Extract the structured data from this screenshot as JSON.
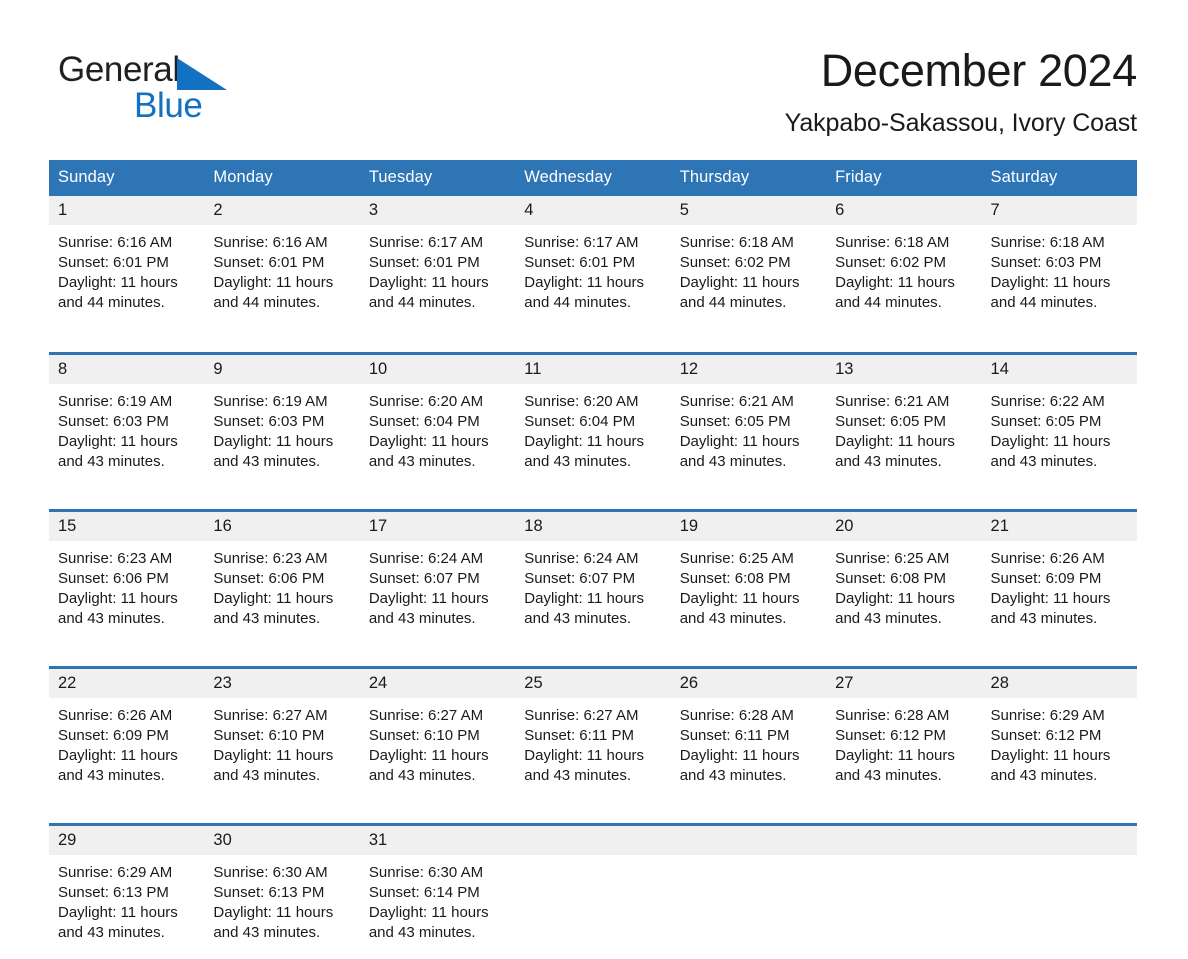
{
  "brand": {
    "name_part1": "General",
    "name_part2": "Blue",
    "triangle_color": "#1271c1"
  },
  "header": {
    "title": "December 2024",
    "subtitle": "Yakpabo-Sakassou, Ivory Coast"
  },
  "theme": {
    "header_blue": "#2e75b6",
    "date_band_gray": "#f0f0f0",
    "text_color": "#1a1a1a"
  },
  "weekday_headers": [
    "Sunday",
    "Monday",
    "Tuesday",
    "Wednesday",
    "Thursday",
    "Friday",
    "Saturday"
  ],
  "weeks": [
    {
      "days": [
        {
          "date": "1",
          "sunrise": "Sunrise: 6:16 AM",
          "sunset": "Sunset: 6:01 PM",
          "daylight_line1": "Daylight: 11 hours",
          "daylight_line2": "and 44 minutes."
        },
        {
          "date": "2",
          "sunrise": "Sunrise: 6:16 AM",
          "sunset": "Sunset: 6:01 PM",
          "daylight_line1": "Daylight: 11 hours",
          "daylight_line2": "and 44 minutes."
        },
        {
          "date": "3",
          "sunrise": "Sunrise: 6:17 AM",
          "sunset": "Sunset: 6:01 PM",
          "daylight_line1": "Daylight: 11 hours",
          "daylight_line2": "and 44 minutes."
        },
        {
          "date": "4",
          "sunrise": "Sunrise: 6:17 AM",
          "sunset": "Sunset: 6:01 PM",
          "daylight_line1": "Daylight: 11 hours",
          "daylight_line2": "and 44 minutes."
        },
        {
          "date": "5",
          "sunrise": "Sunrise: 6:18 AM",
          "sunset": "Sunset: 6:02 PM",
          "daylight_line1": "Daylight: 11 hours",
          "daylight_line2": "and 44 minutes."
        },
        {
          "date": "6",
          "sunrise": "Sunrise: 6:18 AM",
          "sunset": "Sunset: 6:02 PM",
          "daylight_line1": "Daylight: 11 hours",
          "daylight_line2": "and 44 minutes."
        },
        {
          "date": "7",
          "sunrise": "Sunrise: 6:18 AM",
          "sunset": "Sunset: 6:03 PM",
          "daylight_line1": "Daylight: 11 hours",
          "daylight_line2": "and 44 minutes."
        }
      ]
    },
    {
      "days": [
        {
          "date": "8",
          "sunrise": "Sunrise: 6:19 AM",
          "sunset": "Sunset: 6:03 PM",
          "daylight_line1": "Daylight: 11 hours",
          "daylight_line2": "and 43 minutes."
        },
        {
          "date": "9",
          "sunrise": "Sunrise: 6:19 AM",
          "sunset": "Sunset: 6:03 PM",
          "daylight_line1": "Daylight: 11 hours",
          "daylight_line2": "and 43 minutes."
        },
        {
          "date": "10",
          "sunrise": "Sunrise: 6:20 AM",
          "sunset": "Sunset: 6:04 PM",
          "daylight_line1": "Daylight: 11 hours",
          "daylight_line2": "and 43 minutes."
        },
        {
          "date": "11",
          "sunrise": "Sunrise: 6:20 AM",
          "sunset": "Sunset: 6:04 PM",
          "daylight_line1": "Daylight: 11 hours",
          "daylight_line2": "and 43 minutes."
        },
        {
          "date": "12",
          "sunrise": "Sunrise: 6:21 AM",
          "sunset": "Sunset: 6:05 PM",
          "daylight_line1": "Daylight: 11 hours",
          "daylight_line2": "and 43 minutes."
        },
        {
          "date": "13",
          "sunrise": "Sunrise: 6:21 AM",
          "sunset": "Sunset: 6:05 PM",
          "daylight_line1": "Daylight: 11 hours",
          "daylight_line2": "and 43 minutes."
        },
        {
          "date": "14",
          "sunrise": "Sunrise: 6:22 AM",
          "sunset": "Sunset: 6:05 PM",
          "daylight_line1": "Daylight: 11 hours",
          "daylight_line2": "and 43 minutes."
        }
      ]
    },
    {
      "days": [
        {
          "date": "15",
          "sunrise": "Sunrise: 6:23 AM",
          "sunset": "Sunset: 6:06 PM",
          "daylight_line1": "Daylight: 11 hours",
          "daylight_line2": "and 43 minutes."
        },
        {
          "date": "16",
          "sunrise": "Sunrise: 6:23 AM",
          "sunset": "Sunset: 6:06 PM",
          "daylight_line1": "Daylight: 11 hours",
          "daylight_line2": "and 43 minutes."
        },
        {
          "date": "17",
          "sunrise": "Sunrise: 6:24 AM",
          "sunset": "Sunset: 6:07 PM",
          "daylight_line1": "Daylight: 11 hours",
          "daylight_line2": "and 43 minutes."
        },
        {
          "date": "18",
          "sunrise": "Sunrise: 6:24 AM",
          "sunset": "Sunset: 6:07 PM",
          "daylight_line1": "Daylight: 11 hours",
          "daylight_line2": "and 43 minutes."
        },
        {
          "date": "19",
          "sunrise": "Sunrise: 6:25 AM",
          "sunset": "Sunset: 6:08 PM",
          "daylight_line1": "Daylight: 11 hours",
          "daylight_line2": "and 43 minutes."
        },
        {
          "date": "20",
          "sunrise": "Sunrise: 6:25 AM",
          "sunset": "Sunset: 6:08 PM",
          "daylight_line1": "Daylight: 11 hours",
          "daylight_line2": "and 43 minutes."
        },
        {
          "date": "21",
          "sunrise": "Sunrise: 6:26 AM",
          "sunset": "Sunset: 6:09 PM",
          "daylight_line1": "Daylight: 11 hours",
          "daylight_line2": "and 43 minutes."
        }
      ]
    },
    {
      "days": [
        {
          "date": "22",
          "sunrise": "Sunrise: 6:26 AM",
          "sunset": "Sunset: 6:09 PM",
          "daylight_line1": "Daylight: 11 hours",
          "daylight_line2": "and 43 minutes."
        },
        {
          "date": "23",
          "sunrise": "Sunrise: 6:27 AM",
          "sunset": "Sunset: 6:10 PM",
          "daylight_line1": "Daylight: 11 hours",
          "daylight_line2": "and 43 minutes."
        },
        {
          "date": "24",
          "sunrise": "Sunrise: 6:27 AM",
          "sunset": "Sunset: 6:10 PM",
          "daylight_line1": "Daylight: 11 hours",
          "daylight_line2": "and 43 minutes."
        },
        {
          "date": "25",
          "sunrise": "Sunrise: 6:27 AM",
          "sunset": "Sunset: 6:11 PM",
          "daylight_line1": "Daylight: 11 hours",
          "daylight_line2": "and 43 minutes."
        },
        {
          "date": "26",
          "sunrise": "Sunrise: 6:28 AM",
          "sunset": "Sunset: 6:11 PM",
          "daylight_line1": "Daylight: 11 hours",
          "daylight_line2": "and 43 minutes."
        },
        {
          "date": "27",
          "sunrise": "Sunrise: 6:28 AM",
          "sunset": "Sunset: 6:12 PM",
          "daylight_line1": "Daylight: 11 hours",
          "daylight_line2": "and 43 minutes."
        },
        {
          "date": "28",
          "sunrise": "Sunrise: 6:29 AM",
          "sunset": "Sunset: 6:12 PM",
          "daylight_line1": "Daylight: 11 hours",
          "daylight_line2": "and 43 minutes."
        }
      ]
    },
    {
      "days": [
        {
          "date": "29",
          "sunrise": "Sunrise: 6:29 AM",
          "sunset": "Sunset: 6:13 PM",
          "daylight_line1": "Daylight: 11 hours",
          "daylight_line2": "and 43 minutes."
        },
        {
          "date": "30",
          "sunrise": "Sunrise: 6:30 AM",
          "sunset": "Sunset: 6:13 PM",
          "daylight_line1": "Daylight: 11 hours",
          "daylight_line2": "and 43 minutes."
        },
        {
          "date": "31",
          "sunrise": "Sunrise: 6:30 AM",
          "sunset": "Sunset: 6:14 PM",
          "daylight_line1": "Daylight: 11 hours",
          "daylight_line2": "and 43 minutes."
        },
        {
          "date": "",
          "sunrise": "",
          "sunset": "",
          "daylight_line1": "",
          "daylight_line2": ""
        },
        {
          "date": "",
          "sunrise": "",
          "sunset": "",
          "daylight_line1": "",
          "daylight_line2": ""
        },
        {
          "date": "",
          "sunrise": "",
          "sunset": "",
          "daylight_line1": "",
          "daylight_line2": ""
        },
        {
          "date": "",
          "sunrise": "",
          "sunset": "",
          "daylight_line1": "",
          "daylight_line2": ""
        }
      ]
    }
  ]
}
